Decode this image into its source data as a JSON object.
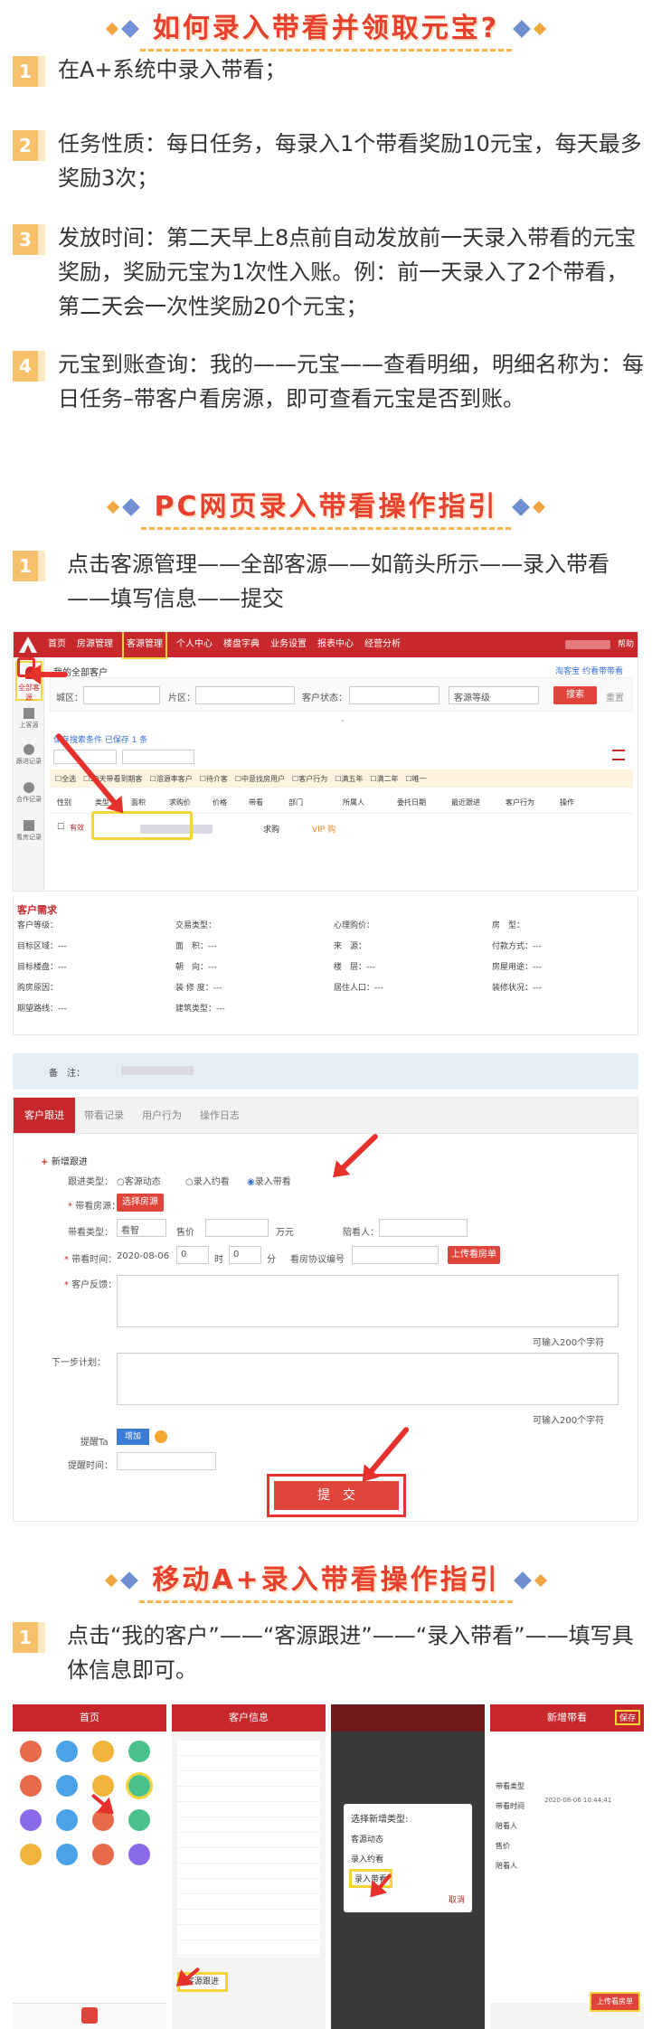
{
  "section1": {
    "title": "如何录入带看并领取元宝?",
    "steps": [
      {
        "num": "1",
        "text": "在A+系统中录入带看；"
      },
      {
        "num": "2",
        "text": "任务性质：每日任务，每录入1个带看奖励10元宝，每天最多奖励3次；"
      },
      {
        "num": "3",
        "text": "发放时间：第二天早上8点前自动发放前一天录入带看的元宝奖励，奖励元宝为1次性入账。例：前一天录入了2个带看，第二天会一次性奖励20个元宝；"
      },
      {
        "num": "4",
        "text": "元宝到账查询：我的——元宝——查看明细，明细名称为：每日任务–带客户看房源，即可查看元宝是否到账。"
      }
    ]
  },
  "section2": {
    "title": "PC网页录入带看操作指引",
    "step": {
      "num": "1",
      "text": "点击客源管理——全部客源——如箭头所示——录入带看——填写信息——提交"
    }
  },
  "pc": {
    "nav": [
      "首页",
      "房源管理",
      "客源管理",
      "个人中心",
      "楼盘字典",
      "业务设置",
      "报表中心",
      "经营分析"
    ],
    "nav_right": "帮助",
    "side": [
      "全部客源",
      "上客源",
      "跟进记录",
      "合作记录",
      "看房记录"
    ],
    "header_title": "我的全部客户",
    "header_right": "淘客宝  约看带带看",
    "filters": [
      "城区：",
      "片区：",
      "客户状态："
    ],
    "filter_select": "客源等级",
    "search_btn": "搜索",
    "reset": "重置",
    "saved": "保存搜索条件  已保存 1 条",
    "check_opts": [
      "全选",
      "30天带看到期客",
      "溶源率客户",
      "待介客",
      "中意找房用户",
      "客户行为",
      "满五年",
      "满二年",
      "唯一"
    ],
    "cols": [
      "性别",
      "类型",
      "面积",
      "求购价",
      "价格",
      "带看",
      "部门",
      "所属人",
      "委托日期",
      "最近跟进",
      "客户行为",
      "操作"
    ],
    "row": {
      "tag": "有效",
      "type": "求购",
      "vip": "VIP 购"
    },
    "demand_title": "客户需求",
    "demand_fields": [
      "客户等级：",
      "交易类型：",
      "心理购价：",
      "房　型：",
      "目标区域：---",
      "面　积：---",
      "来　源：",
      "付款方式：---",
      "目标楼盘：---",
      "朝　向：---",
      "楼　层：---",
      "房屋用途：---",
      "购房原因：",
      "装 修 度：---",
      "居住人口：---",
      "装修状况：---",
      "期望路线：---",
      "建筑类型：---"
    ],
    "remark": "备　注：",
    "tabs": [
      "客户跟进",
      "带看记录",
      "用户行为",
      "操作日志"
    ],
    "new_follow": "新增跟进",
    "follow_type_label": "跟进类型：",
    "radios": [
      "客源动态",
      "录入约看",
      "录入带看"
    ],
    "house_label": "带看房源：",
    "house_btn": "选择房源",
    "type_label": "带看类型：",
    "type_value": "看智",
    "price_label": "售价",
    "price_unit": "万元",
    "companion_label": "陪看人：",
    "time_label": "带看时间：",
    "date_value": "2020-08-06",
    "hour": "0",
    "hour_unit": "时",
    "minute": "0",
    "minute_unit": "分",
    "agreement_label": "看房协议编号",
    "upload_btn": "上传看房单",
    "feedback_label": "客户反馈：",
    "limit1": "可输入200个字符",
    "plan_label": "下一步计划：",
    "limit2": "可输入200个字符",
    "remind_label": "提醒Ta",
    "remind_btn": "增加",
    "remind_time": "提醒时间：",
    "submit": "提　交"
  },
  "section3": {
    "title": "移动A+录入带看操作指引",
    "step": {
      "num": "1",
      "text": "点击“我的客户”——“客源跟进”——“录入带看”——填写具体信息即可。"
    }
  },
  "mobile": {
    "s1_title": "首页",
    "s2_title": "客户信息",
    "s2_follow": "客源跟进",
    "s3_title": "选择新增类型:",
    "s3_opts": [
      "客源动态",
      "录入约看",
      "录入带看"
    ],
    "s3_cancel": "取消",
    "s4_title": "新增带看",
    "s4_save": "保存",
    "s4_fields": [
      "带看类型",
      "带看时间",
      "陪看人",
      "售价",
      "陪看人"
    ],
    "s4_date": "2020-08-06  10:44:41",
    "s4_btn": "上传看房单"
  },
  "colors": {
    "accent": "#e8402f",
    "nav": "#c6282b",
    "yellow": "#f4d43a",
    "step": "#f7c16b"
  }
}
